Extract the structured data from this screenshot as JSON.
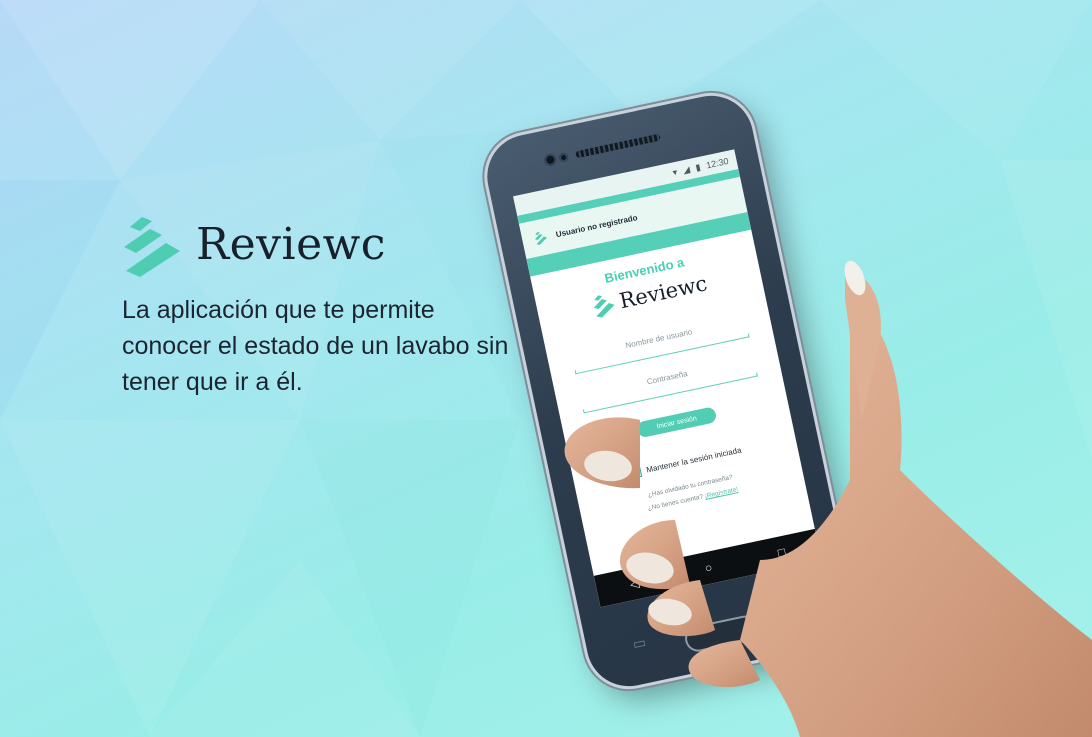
{
  "brand": {
    "name": "Reviewc",
    "tagline": "La aplicación que te permite conocer el estado de un lavabo sin tener que ir a él."
  },
  "phone": {
    "status_time": "12:30",
    "appbar_title": "Usuario no registrado",
    "welcome": "Bienvenido a",
    "app_name": "Reviewc",
    "username_placeholder": "Nombre de usuario",
    "password_placeholder": "Contraseña",
    "login_button": "Iniciar sesión",
    "keep_session": "Mantener la sesión iniciada",
    "keep_session_checked": true,
    "forgot_password": "¿Has olvidado tu contraseña?",
    "no_account": "¿No tienes cuenta?",
    "register_link": "¡Regístrate!",
    "nav": {
      "back": "◁",
      "home": "○",
      "recent": "□"
    }
  },
  "colors": {
    "accent": "#55cfb7",
    "text_dark": "#17202b",
    "background": "#a5e6f0"
  }
}
